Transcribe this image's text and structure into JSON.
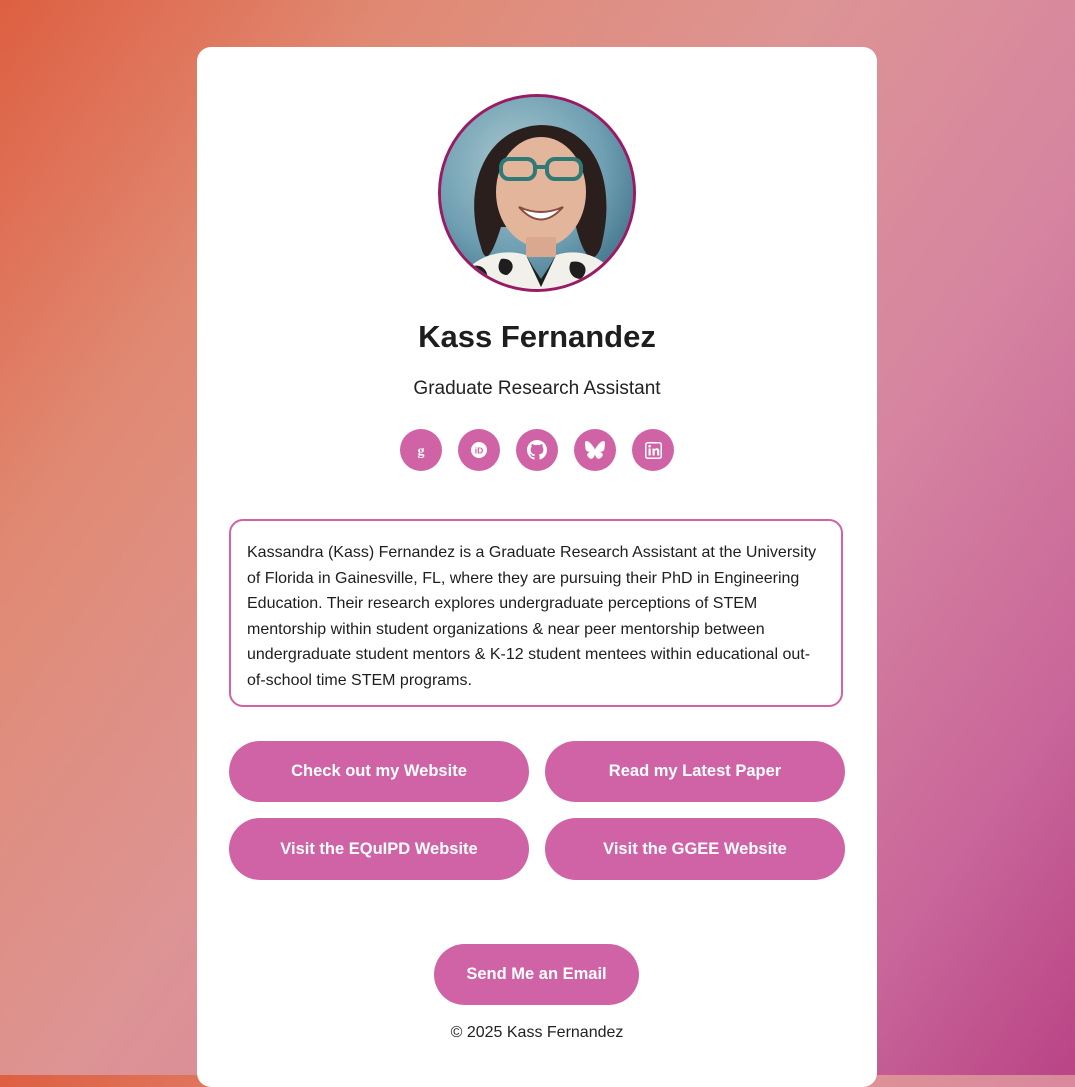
{
  "profile": {
    "name": "Kass Fernandez",
    "title": "Graduate Research Assistant",
    "bio": "Kassandra (Kass) Fernandez is a Graduate Research Assistant at the University of Florida in Gainesville, FL, where they are pursuing their PhD in Engineering Education. Their research explores undergraduate perceptions of STEM mentorship within student organizations & near peer mentorship between undergraduate student mentors & K-12 student mentees within educational out-of-school time STEM programs."
  },
  "social_links": [
    {
      "icon": "google-scholar-icon"
    },
    {
      "icon": "orcid-icon"
    },
    {
      "icon": "github-icon"
    },
    {
      "icon": "bluesky-icon"
    },
    {
      "icon": "linkedin-icon"
    }
  ],
  "buttons": {
    "website": "Check out my Website",
    "paper": "Read my Latest Paper",
    "equipd": "Visit the EQuIPD Website",
    "ggee": "Visit the GGEE Website",
    "email": "Send Me an Email"
  },
  "footer": {
    "copyright": "© 2025 Kass Fernandez"
  },
  "colors": {
    "accent": "#d062a6",
    "avatar_border": "#9c1a63",
    "background_start": "#de5f41",
    "background_end": "#b94486"
  }
}
